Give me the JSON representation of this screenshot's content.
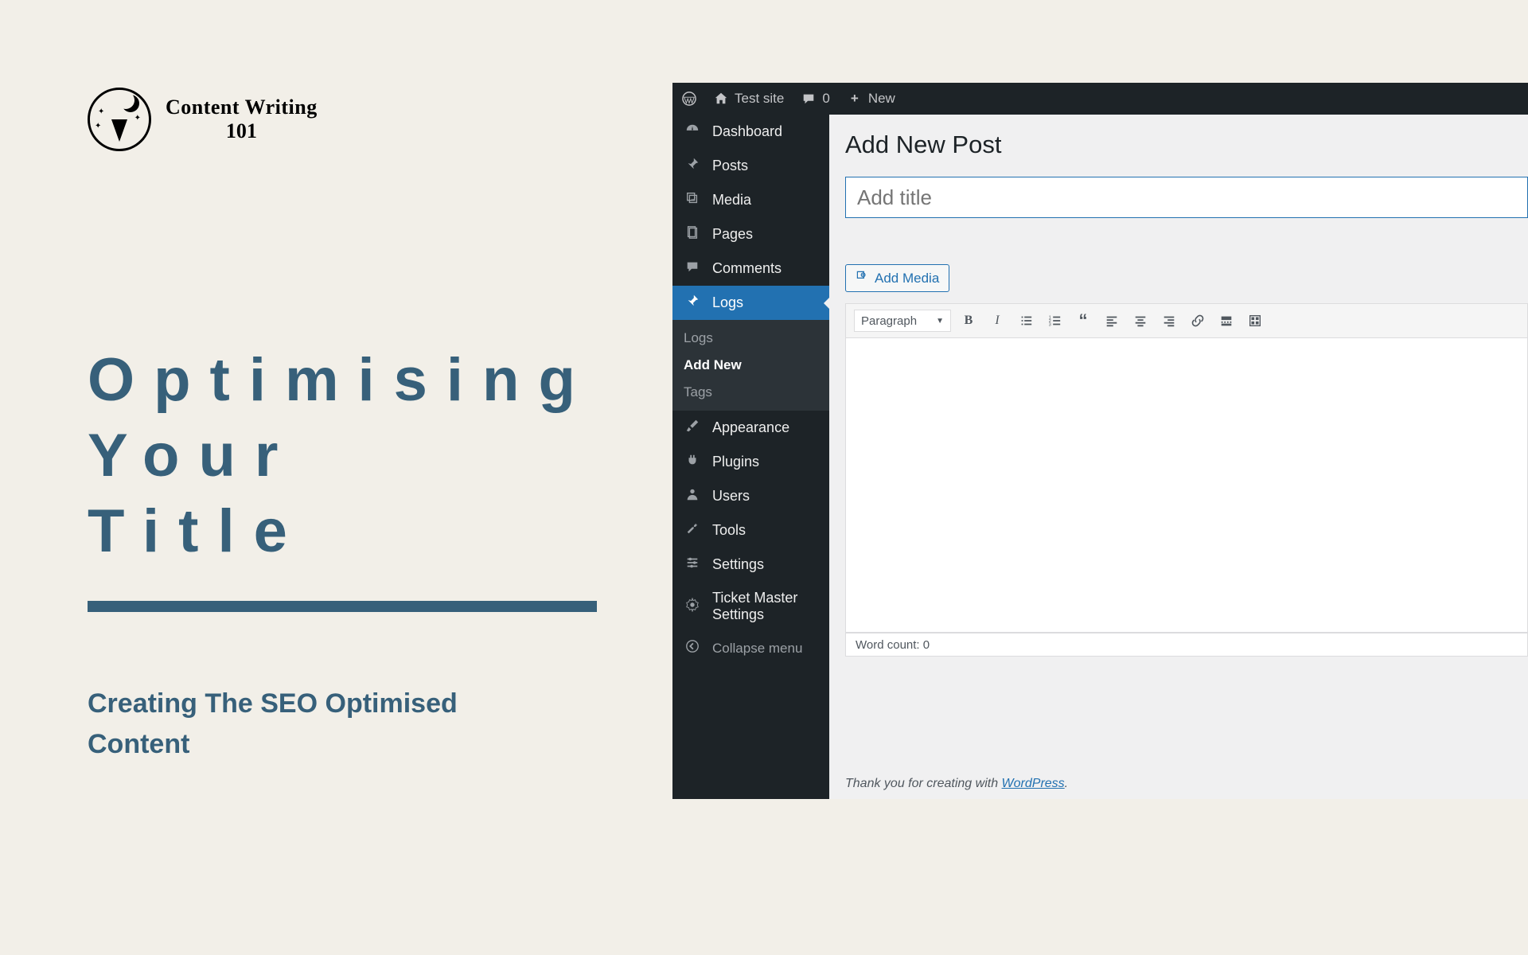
{
  "logo": {
    "line1": "Content Writing",
    "line2": "101"
  },
  "hero": {
    "title_line1": "Optimising Your",
    "title_line2": "Title",
    "subtitle": "Creating The SEO Optimised Content"
  },
  "wp": {
    "adminbar": {
      "site_name": "Test site",
      "comment_count": "0",
      "new_label": "New"
    },
    "menu": {
      "dashboard": "Dashboard",
      "posts": "Posts",
      "media": "Media",
      "pages": "Pages",
      "comments": "Comments",
      "logs": "Logs",
      "appearance": "Appearance",
      "plugins": "Plugins",
      "users": "Users",
      "tools": "Tools",
      "settings": "Settings",
      "ticket_master": "Ticket Master Settings",
      "collapse": "Collapse menu"
    },
    "submenu": {
      "logs": "Logs",
      "add_new": "Add New",
      "tags": "Tags"
    },
    "page": {
      "heading": "Add New Post",
      "title_placeholder": "Add title",
      "add_media": "Add Media",
      "format_select": "Paragraph",
      "word_count": "Word count: 0",
      "thanks_prefix": "Thank you for creating with ",
      "thanks_link": "WordPress",
      "thanks_suffix": "."
    }
  }
}
